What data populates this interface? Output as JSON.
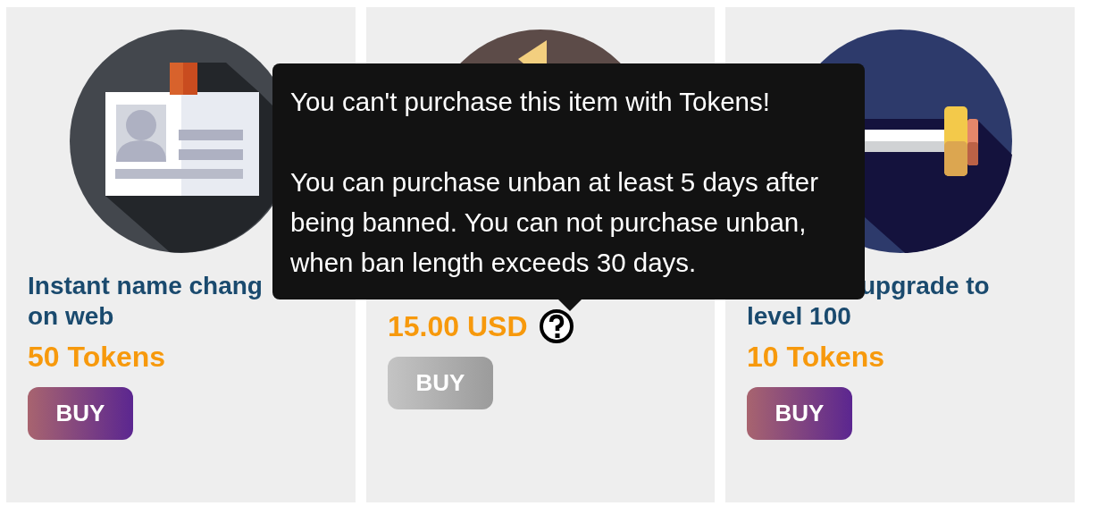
{
  "cards": [
    {
      "title_lines": [
        "Instant name chang",
        "on web"
      ],
      "price": "50 Tokens",
      "help": false,
      "buy": {
        "label": "BUY",
        "disabled": false
      }
    },
    {
      "price": "15.00 USD",
      "help": true,
      "buy": {
        "label": "BUY",
        "disabled": true
      }
    },
    {
      "title_lines": [
        "upgrade to",
        "level 100"
      ],
      "price": "10 Tokens",
      "help": false,
      "buy": {
        "label": "BUY",
        "disabled": false
      }
    }
  ],
  "tooltip": {
    "paragraphs": [
      "You can't purchase this item with Tokens!",
      "You can purchase unban at least 5 days after being banned. You can not purchase unban, when ban length exceeds 30 days."
    ]
  }
}
